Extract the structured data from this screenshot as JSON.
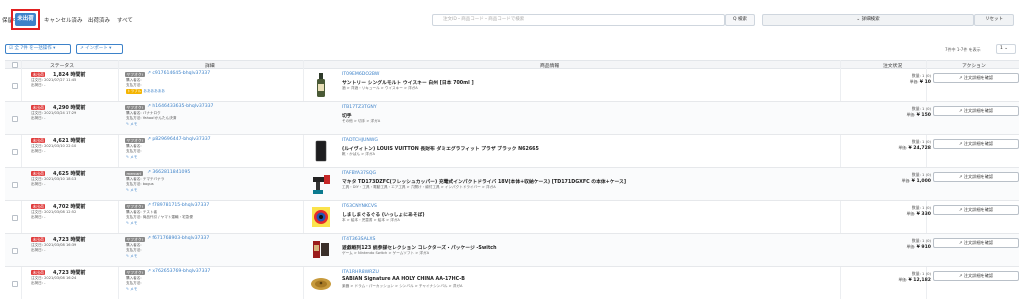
{
  "tabs": {
    "hold": "保留中",
    "unshipped": "未出荷",
    "cancelled": "キャンセル済み",
    "shipped": "出荷済み",
    "all": "すべて"
  },
  "search": {
    "placeholder": "注文ID・商品コード・商品コードで検索",
    "button": "Q 検索",
    "detail": "⌄ 詳細検索",
    "reset": "リセット"
  },
  "toolbar": {
    "bulk": "☑ 全 7件 を一括操作 ▾",
    "import": "↗ インポート ▾",
    "pager": "7件中 1-7件 を表示",
    "per_page": "1 ⌄"
  },
  "headers": {
    "status": "ステータス",
    "detail": "詳細",
    "product": "商品情報",
    "order_status": "注文状況",
    "action": "アクション"
  },
  "rows": [
    {
      "badge": "未出荷",
      "hours": "1,824 時間前",
      "ordered": "注文日: 2021/07/27 11:45",
      "shipped": "出荷日: -",
      "tag": "ヤフオク!",
      "order": "c917614645-bhqlv37337",
      "buyer": "購入者名:",
      "pay": "支払方法:",
      "memo_tag": "トラブル",
      "memo": "ああああああ",
      "asin": "IT09EM6DO2BW",
      "name": "サントリー シングルモルト ウイスキー 白州 [日本 700ml ]",
      "cat": "酒 > 洋酒・リキュール > ウイスキー > 洋ガA",
      "qty": "数量: 1 (0)",
      "price_label": "単価:",
      "price": "¥ 10",
      "thumb": "bottle"
    },
    {
      "badge": "未出荷",
      "hours": "4,290 時間前",
      "ordered": "注文日: 2021/03/24 17:29",
      "shipped": "出荷日: -",
      "tag": "ヤフオク!",
      "order": "h1646433635-bhqlv37337",
      "buyer": "購入者名: バナナロク",
      "pay": "支払方法: Yahoo!かんたん決済",
      "memo_tag": "",
      "memo": "✎ メモ",
      "asin": "ITB17TZ3TGNY",
      "name": "切手",
      "cat": "その他 > 切手 > 洋ガA",
      "qty": "数量: 1 (0)",
      "price_label": "単価:",
      "price": "¥ 150",
      "thumb": "none"
    },
    {
      "badge": "未出荷",
      "hours": "4,621 時間前",
      "ordered": "注文日: 2021/03/10 22:10",
      "shipped": "出荷日: -",
      "tag": "ヤフオク!",
      "order": "p829696447-bhqlv37337",
      "buyer": "購入者名:",
      "pay": "支払方法:",
      "memo_tag": "",
      "memo": "✎ メモ",
      "asin": "ITADTCHJUNWG",
      "name": "(ルイヴィトン) LOUIS VUITTON 長財布 ダミエグラフィット プラザ ブラック N62665",
      "cat": "靴・かばん > 洋ガA",
      "qty": "数量: 1 (0)",
      "price_label": "単価:",
      "price": "¥ 24,728",
      "thumb": "wallet"
    },
    {
      "badge": "未出荷",
      "hours": "4,625 時間前",
      "ordered": "注文日: 2021/03/10 18:13",
      "shipped": "出荷日: -",
      "tag": "mercari",
      "order": "3662811841095",
      "buyer": "購入者名: テマテバナラ",
      "pay": "支払方法: bogus",
      "memo_tag": "",
      "memo": "✎ メモ",
      "asin": "ITAFBYA37SQG",
      "name": "マキタ TD173DZFC(フレッシュカッパー) 充電式インパクトドライバ 18V(本体+収納ケース) [TD171DGXFC の本体+ケース]",
      "cat": "工具・DIY・工具・電動工具・エア工具 > 穴開け・締付工具 > インパクトドライバー > 洋ガA",
      "qty": "数量: 1 (0)",
      "price_label": "単価:",
      "price": "¥ 1,000",
      "thumb": "tool"
    },
    {
      "badge": "未出荷",
      "hours": "4,702 時間前",
      "ordered": "注文日: 2021/03/08 12:52",
      "shipped": "出荷日: -",
      "tag": "ヤフオク!",
      "order": "f789781715-bhqlv37337",
      "buyer": "購入者名: テスト者",
      "pay": "支払方法: 商品代引 / ヤマト運輸・宅急便",
      "memo_tag": "",
      "memo": "✎ メモ",
      "asin": "IT63CNYNKCVS",
      "name": "しましまぐるぐる (いっしょにあそぼ)",
      "cat": "本 > 絵本・児童書 > 絵本 > 洋ガA",
      "qty": "数量: 1 (0)",
      "price_label": "単価:",
      "price": "¥ 330",
      "thumb": "book"
    },
    {
      "badge": "未出荷",
      "hours": "4,723 時間前",
      "ordered": "注文日: 2021/03/08 16:39",
      "shipped": "出荷日: -",
      "tag": "ヤフオク!",
      "order": "f671768903-bhqlv37337",
      "buyer": "購入者名:",
      "pay": "支払方法:",
      "memo_tag": "",
      "memo": "✎ メモ",
      "asin": "IT4T363SALXS",
      "name": "遊戯戦列123 統参謀セレクション コレクターズ・パッケージ -Switch",
      "cat": "ゲーム > Nintendo Switch > ゲームソフト > 洋ガA",
      "qty": "数量: 1 (0)",
      "price_label": "単価:",
      "price": "¥ 910",
      "thumb": "game"
    },
    {
      "badge": "未出荷",
      "hours": "4,723 時間前",
      "ordered": "注文日: 2021/03/08 16:24",
      "shipped": "出荷日: -",
      "tag": "ヤフオク!",
      "order": "x762653769-bhqlv37337",
      "buyer": "購入者名:",
      "pay": "支払方法:",
      "memo_tag": "",
      "memo": "✎ メモ",
      "asin": "ITA1RHR8WRZU",
      "name": "SABIAN Signature AA HOLY CHINA AA-17HC-B",
      "cat": "楽器 > ドラム・パーカッション > シンバル > チャイナシンバル > 洋ガA",
      "qty": "数量: 1 (0)",
      "price_label": "単価:",
      "price": "¥ 12,182",
      "thumb": "cymbal"
    }
  ],
  "confirm_label": "↗ 注文詳細を確認"
}
